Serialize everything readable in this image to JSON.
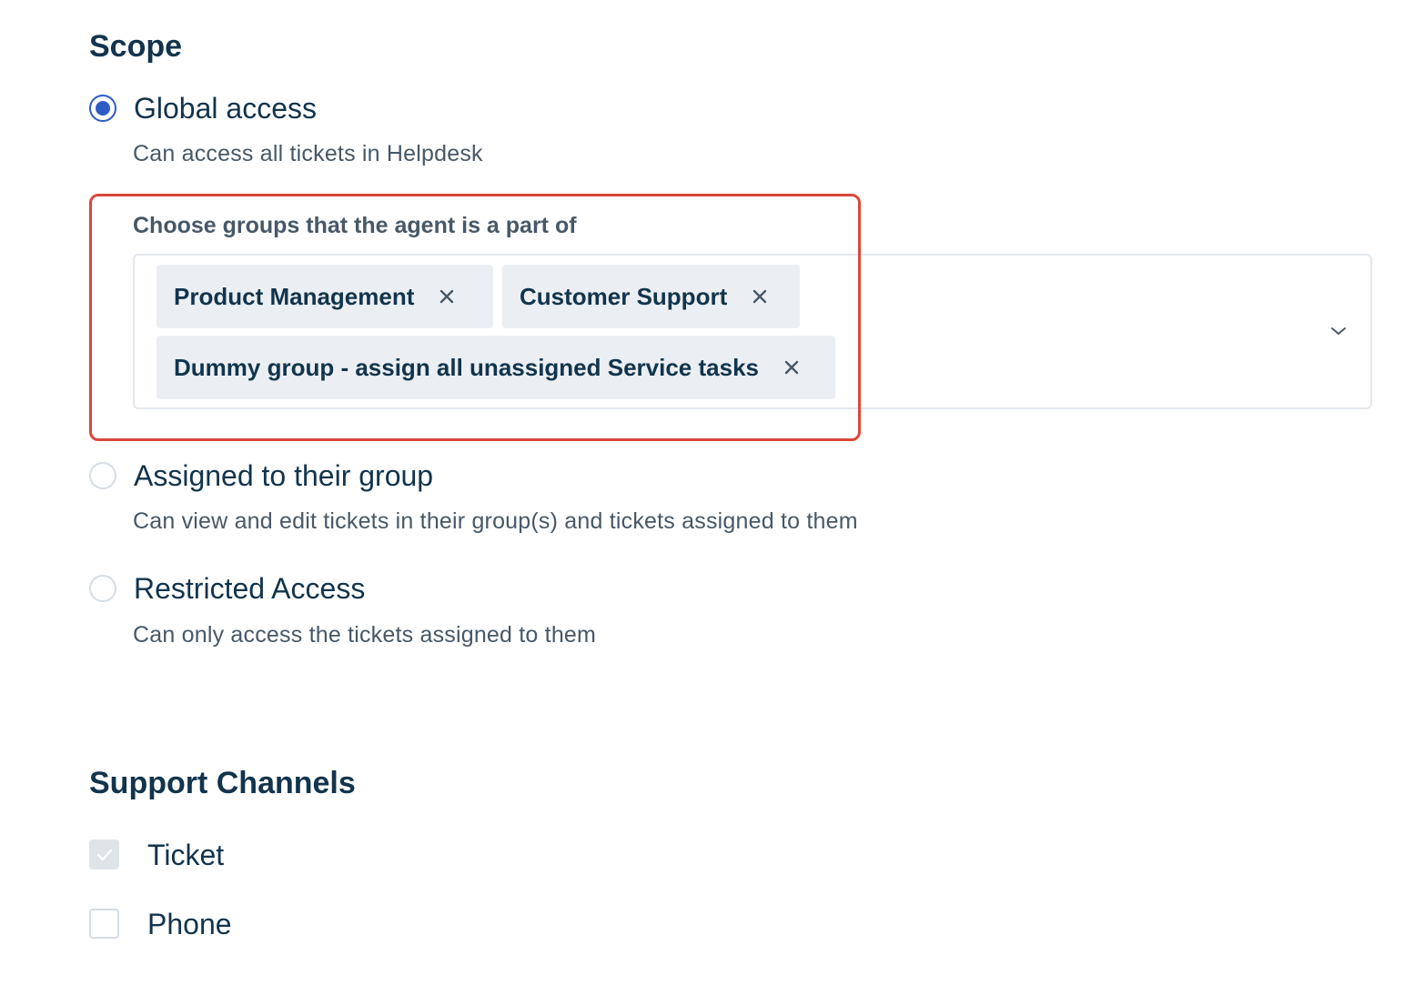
{
  "scope": {
    "title": "Scope",
    "options": [
      {
        "label": "Global access",
        "description": "Can access all tickets in Helpdesk",
        "selected": true
      },
      {
        "label": "Assigned to their group",
        "description": "Can view and edit tickets in their group(s) and tickets assigned to them",
        "selected": false
      },
      {
        "label": "Restricted Access",
        "description": "Can only access the tickets assigned to them",
        "selected": false
      }
    ],
    "groups": {
      "label": "Choose groups that the agent is a part of",
      "selected": [
        "Product Management",
        "Customer Support",
        "Dummy group - assign all unassigned Service tasks"
      ],
      "remove_icon": "close-icon",
      "dropdown_icon": "chevron-down-icon"
    }
  },
  "support_channels": {
    "title": "Support Channels",
    "channels": [
      {
        "label": "Ticket",
        "checked": true,
        "disabled": true
      },
      {
        "label": "Phone",
        "checked": false,
        "disabled": false
      }
    ]
  },
  "colors": {
    "accent": "#2c5cc5",
    "highlight": "#d9483b",
    "chip_bg": "#ebeff3",
    "text_primary": "#12344d",
    "text_secondary": "#475867"
  }
}
